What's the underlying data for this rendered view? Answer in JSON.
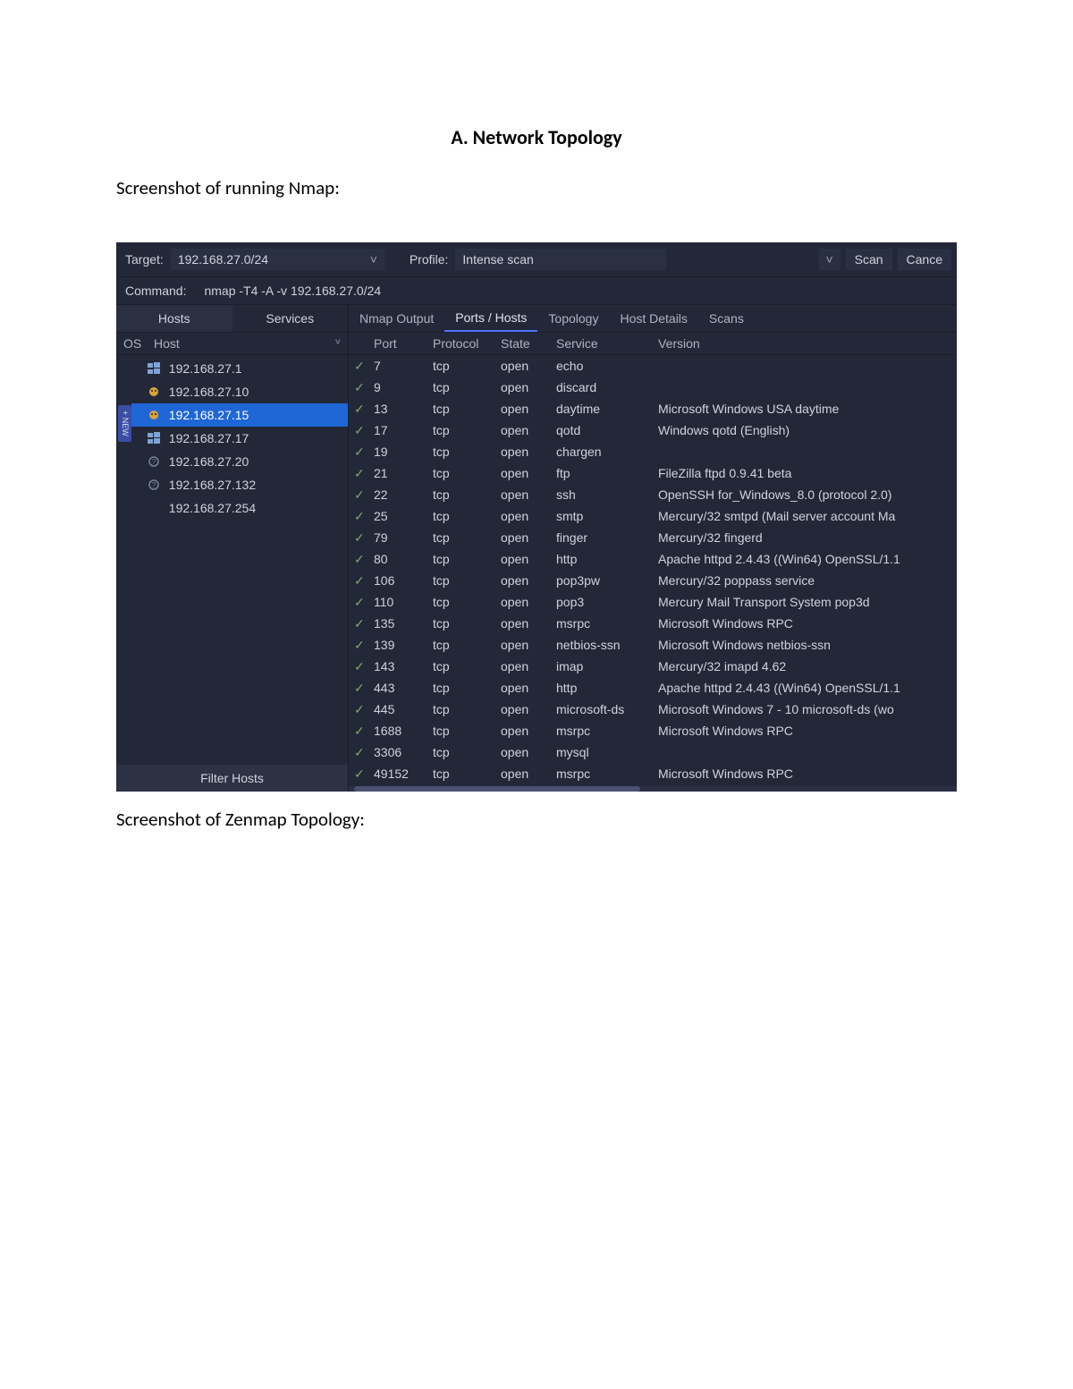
{
  "doc": {
    "heading": "A. Network Topology",
    "caption1_prefix": "Screenshot of ",
    "caption1_mid": "running Nmap",
    "caption1_suffix": ":",
    "caption2_prefix": "Screenshot of ",
    "caption2_mid": "Zenmap Topology",
    "caption2_suffix": ":"
  },
  "toolbar": {
    "target_label": "Target:",
    "target_value": "192.168.27.0/24",
    "profile_label": "Profile:",
    "profile_value": "Intense scan",
    "scan_label": "Scan",
    "cancel_label": "Cance",
    "command_label": "Command:",
    "command_value": "nmap -T4 -A -v 192.168.27.0/24"
  },
  "sidebar": {
    "tab_hosts": "Hosts",
    "tab_services": "Services",
    "header_os": "OS",
    "header_host": "Host",
    "filter_label": "Filter Hosts",
    "strip_label": "+ NEW",
    "hosts": [
      {
        "ip": "192.168.27.1",
        "icon": "windows",
        "selected": false
      },
      {
        "ip": "192.168.27.10",
        "icon": "linux",
        "selected": false
      },
      {
        "ip": "192.168.27.15",
        "icon": "linux",
        "selected": true
      },
      {
        "ip": "192.168.27.17",
        "icon": "windows",
        "selected": false
      },
      {
        "ip": "192.168.27.20",
        "icon": "unknown",
        "selected": false
      },
      {
        "ip": "192.168.27.132",
        "icon": "unknown",
        "selected": false
      },
      {
        "ip": "192.168.27.254",
        "icon": "none",
        "selected": false
      }
    ]
  },
  "main_tabs": {
    "nmap_output": "Nmap Output",
    "ports_hosts": "Ports / Hosts",
    "topology": "Topology",
    "host_details": "Host Details",
    "scans": "Scans"
  },
  "port_table": {
    "headers": {
      "port": "Port",
      "protocol": "Protocol",
      "state": "State",
      "service": "Service",
      "version": "Version"
    },
    "rows": [
      {
        "port": "7",
        "protocol": "tcp",
        "state": "open",
        "service": "echo",
        "version": ""
      },
      {
        "port": "9",
        "protocol": "tcp",
        "state": "open",
        "service": "discard",
        "version": ""
      },
      {
        "port": "13",
        "protocol": "tcp",
        "state": "open",
        "service": "daytime",
        "version": "Microsoft Windows USA daytime"
      },
      {
        "port": "17",
        "protocol": "tcp",
        "state": "open",
        "service": "qotd",
        "version": "Windows qotd (English)"
      },
      {
        "port": "19",
        "protocol": "tcp",
        "state": "open",
        "service": "chargen",
        "version": ""
      },
      {
        "port": "21",
        "protocol": "tcp",
        "state": "open",
        "service": "ftp",
        "version": "FileZilla ftpd 0.9.41 beta"
      },
      {
        "port": "22",
        "protocol": "tcp",
        "state": "open",
        "service": "ssh",
        "version": "OpenSSH for_Windows_8.0 (protocol 2.0)"
      },
      {
        "port": "25",
        "protocol": "tcp",
        "state": "open",
        "service": "smtp",
        "version": "Mercury/32 smtpd (Mail server account Ma"
      },
      {
        "port": "79",
        "protocol": "tcp",
        "state": "open",
        "service": "finger",
        "version": "Mercury/32 fingerd"
      },
      {
        "port": "80",
        "protocol": "tcp",
        "state": "open",
        "service": "http",
        "version": "Apache httpd 2.4.43 ((Win64) OpenSSL/1.1"
      },
      {
        "port": "106",
        "protocol": "tcp",
        "state": "open",
        "service": "pop3pw",
        "version": "Mercury/32 poppass service"
      },
      {
        "port": "110",
        "protocol": "tcp",
        "state": "open",
        "service": "pop3",
        "version": "Mercury Mail Transport System pop3d"
      },
      {
        "port": "135",
        "protocol": "tcp",
        "state": "open",
        "service": "msrpc",
        "version": "Microsoft Windows RPC"
      },
      {
        "port": "139",
        "protocol": "tcp",
        "state": "open",
        "service": "netbios-ssn",
        "version": "Microsoft Windows netbios-ssn"
      },
      {
        "port": "143",
        "protocol": "tcp",
        "state": "open",
        "service": "imap",
        "version": "Mercury/32 imapd 4.62"
      },
      {
        "port": "443",
        "protocol": "tcp",
        "state": "open",
        "service": "http",
        "version": "Apache httpd 2.4.43 ((Win64) OpenSSL/1.1"
      },
      {
        "port": "445",
        "protocol": "tcp",
        "state": "open",
        "service": "microsoft-ds",
        "version": "Microsoft Windows 7 - 10 microsoft-ds (wo"
      },
      {
        "port": "1688",
        "protocol": "tcp",
        "state": "open",
        "service": "msrpc",
        "version": "Microsoft Windows RPC"
      },
      {
        "port": "3306",
        "protocol": "tcp",
        "state": "open",
        "service": "mysql",
        "version": ""
      },
      {
        "port": "49152",
        "protocol": "tcp",
        "state": "open",
        "service": "msrpc",
        "version": "Microsoft Windows RPC"
      }
    ]
  }
}
